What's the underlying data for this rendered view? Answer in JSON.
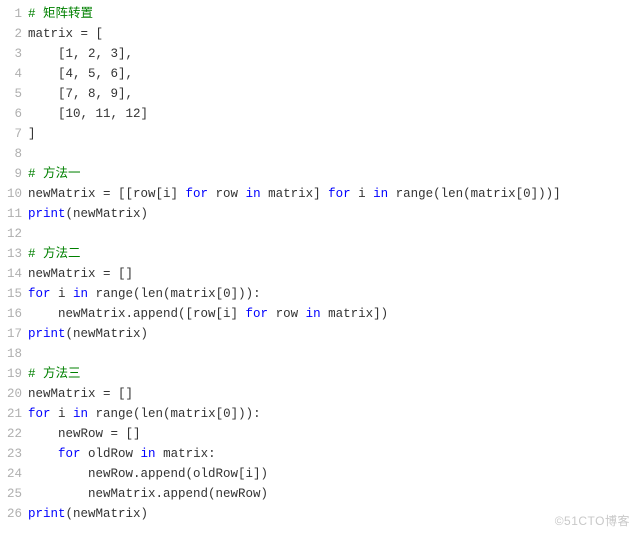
{
  "watermark": "©51CTO博客",
  "code": {
    "lines": [
      {
        "no": 1,
        "tokens": [
          [
            "c",
            "# 矩阵转置"
          ]
        ]
      },
      {
        "no": 2,
        "tokens": [
          [
            "n",
            "matrix = ["
          ]
        ]
      },
      {
        "no": 3,
        "tokens": [
          [
            "n",
            "    [1, 2, 3],"
          ]
        ]
      },
      {
        "no": 4,
        "tokens": [
          [
            "n",
            "    [4, 5, 6],"
          ]
        ]
      },
      {
        "no": 5,
        "tokens": [
          [
            "n",
            "    [7, 8, 9],"
          ]
        ]
      },
      {
        "no": 6,
        "tokens": [
          [
            "n",
            "    [10, 11, 12]"
          ]
        ]
      },
      {
        "no": 7,
        "tokens": [
          [
            "n",
            "]"
          ]
        ]
      },
      {
        "no": 8,
        "tokens": [
          [
            "n",
            ""
          ]
        ]
      },
      {
        "no": 9,
        "tokens": [
          [
            "c",
            "# 方法一"
          ]
        ]
      },
      {
        "no": 10,
        "tokens": [
          [
            "n",
            "newMatrix = [[row[i] "
          ],
          [
            "k",
            "for"
          ],
          [
            "n",
            " row "
          ],
          [
            "k",
            "in"
          ],
          [
            "n",
            " matrix] "
          ],
          [
            "k",
            "for"
          ],
          [
            "n",
            " i "
          ],
          [
            "k",
            "in"
          ],
          [
            "n",
            " range(len(matrix[0]))]"
          ]
        ]
      },
      {
        "no": 11,
        "tokens": [
          [
            "k",
            "print"
          ],
          [
            "n",
            "(newMatrix)"
          ]
        ]
      },
      {
        "no": 12,
        "tokens": [
          [
            "n",
            ""
          ]
        ]
      },
      {
        "no": 13,
        "tokens": [
          [
            "c",
            "# 方法二"
          ]
        ]
      },
      {
        "no": 14,
        "tokens": [
          [
            "n",
            "newMatrix = []"
          ]
        ]
      },
      {
        "no": 15,
        "tokens": [
          [
            "k",
            "for"
          ],
          [
            "n",
            " i "
          ],
          [
            "k",
            "in"
          ],
          [
            "n",
            " range(len(matrix[0])):"
          ]
        ]
      },
      {
        "no": 16,
        "tokens": [
          [
            "n",
            "    newMatrix.append([row[i] "
          ],
          [
            "k",
            "for"
          ],
          [
            "n",
            " row "
          ],
          [
            "k",
            "in"
          ],
          [
            "n",
            " matrix])"
          ]
        ]
      },
      {
        "no": 17,
        "tokens": [
          [
            "k",
            "print"
          ],
          [
            "n",
            "(newMatrix)"
          ]
        ]
      },
      {
        "no": 18,
        "tokens": [
          [
            "n",
            ""
          ]
        ]
      },
      {
        "no": 19,
        "tokens": [
          [
            "c",
            "# 方法三"
          ]
        ]
      },
      {
        "no": 20,
        "tokens": [
          [
            "n",
            "newMatrix = []"
          ]
        ]
      },
      {
        "no": 21,
        "tokens": [
          [
            "k",
            "for"
          ],
          [
            "n",
            " i "
          ],
          [
            "k",
            "in"
          ],
          [
            "n",
            " range(len(matrix[0])):"
          ]
        ]
      },
      {
        "no": 22,
        "tokens": [
          [
            "n",
            "    newRow = []"
          ]
        ]
      },
      {
        "no": 23,
        "tokens": [
          [
            "n",
            "    "
          ],
          [
            "k",
            "for"
          ],
          [
            "n",
            " oldRow "
          ],
          [
            "k",
            "in"
          ],
          [
            "n",
            " matrix:"
          ]
        ]
      },
      {
        "no": 24,
        "tokens": [
          [
            "n",
            "        newRow.append(oldRow[i])"
          ]
        ]
      },
      {
        "no": 25,
        "tokens": [
          [
            "n",
            "        newMatrix.append(newRow)"
          ]
        ]
      },
      {
        "no": 26,
        "tokens": [
          [
            "k",
            "print"
          ],
          [
            "n",
            "(newMatrix)"
          ]
        ]
      }
    ]
  }
}
